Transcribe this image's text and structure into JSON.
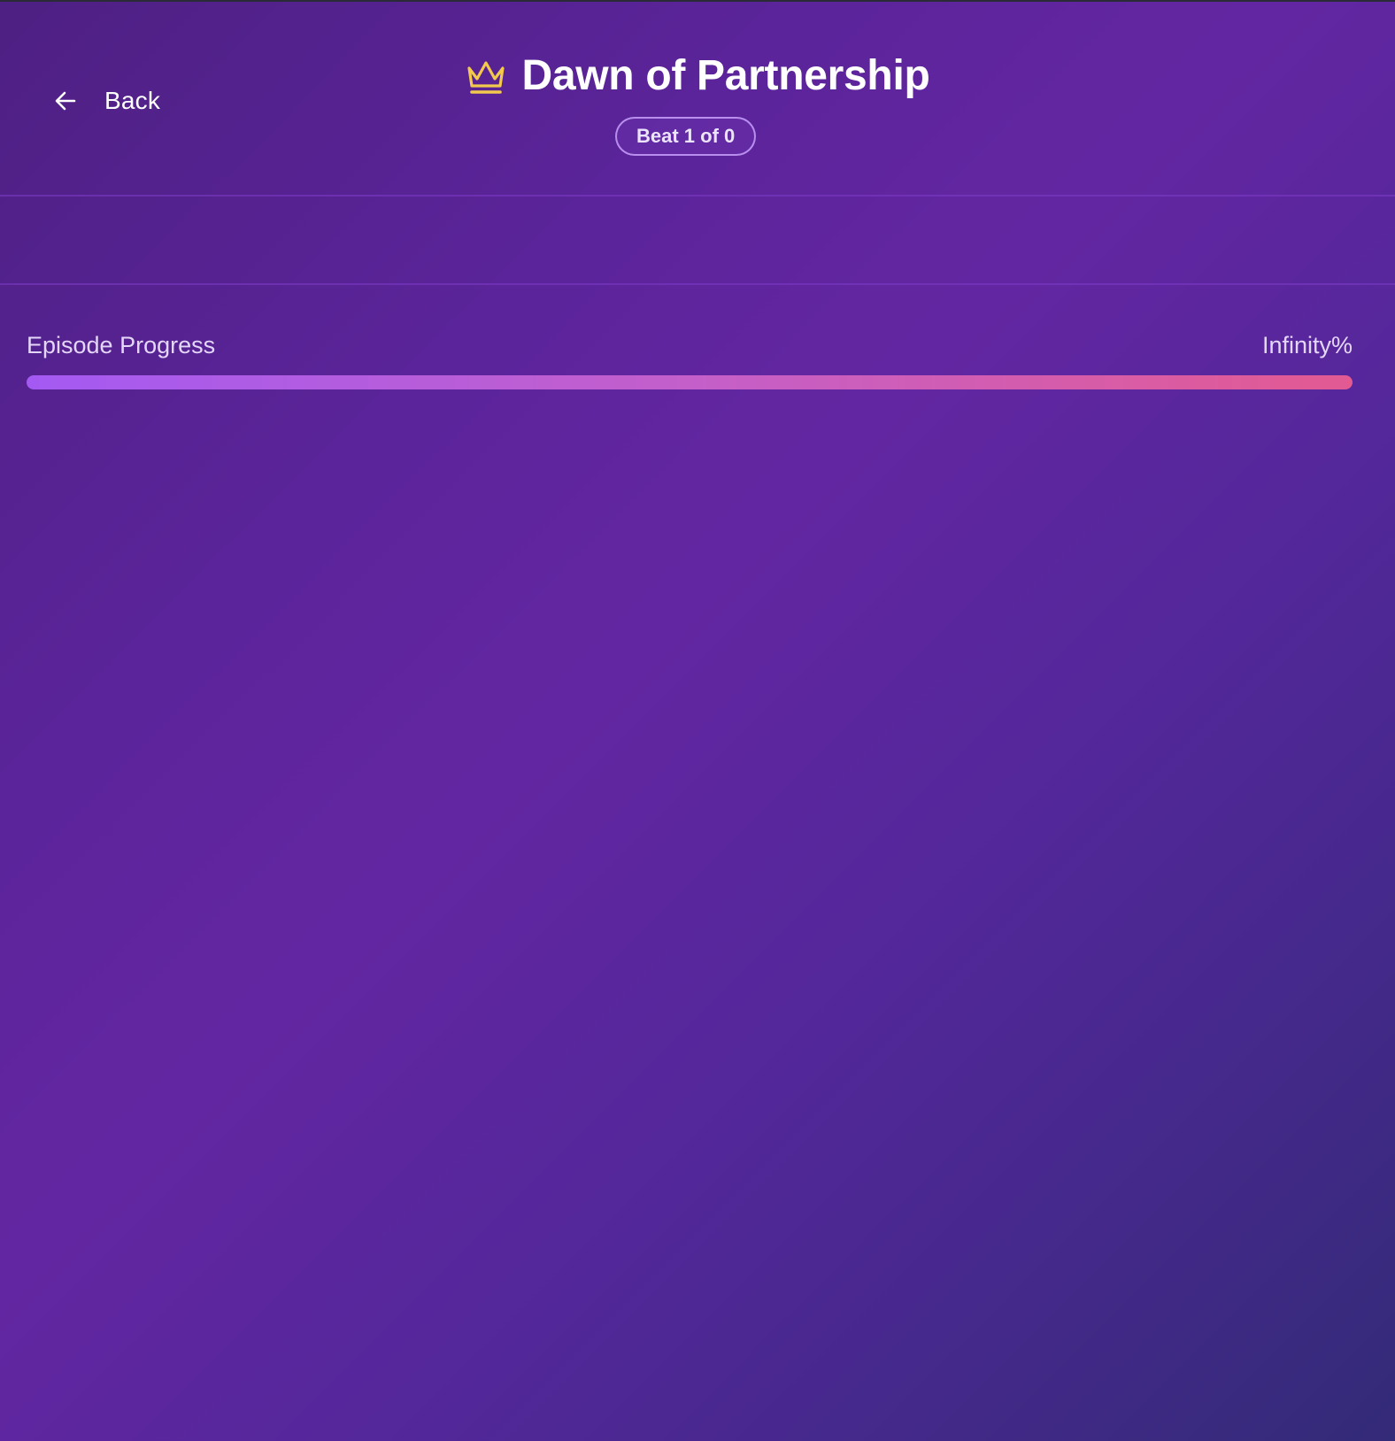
{
  "header": {
    "back_label": "Back",
    "title": "Dawn of Partnership",
    "beat_badge": "Beat 1 of 0",
    "crown_icon_color": "#f2c94c"
  },
  "progress": {
    "label": "Episode Progress",
    "value_text": "Infinity%",
    "fill_fraction": 1.0,
    "gradient_colors": [
      "#a45af2",
      "#e35a92"
    ]
  }
}
